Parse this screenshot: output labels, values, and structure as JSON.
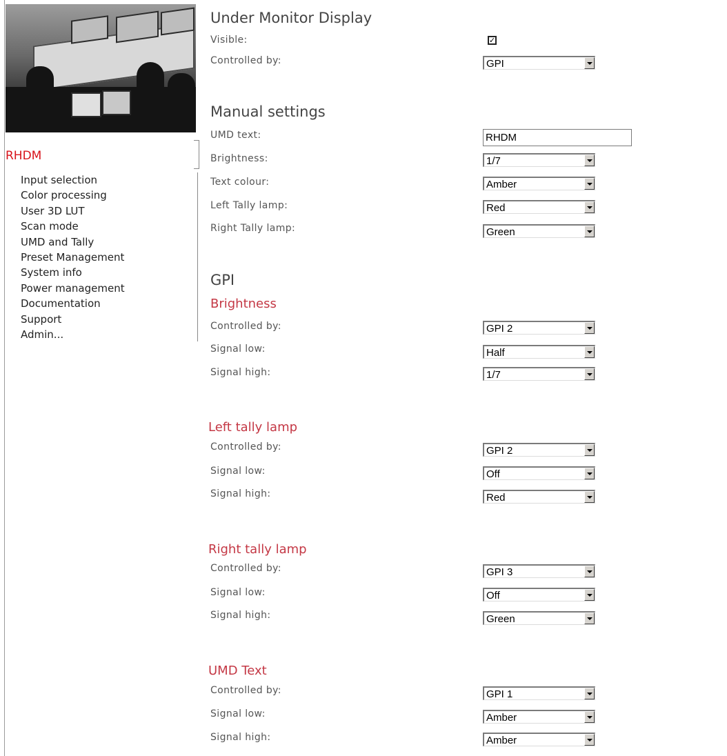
{
  "sidebar": {
    "brand": "RHDM",
    "items": [
      "Input selection",
      "Color processing",
      "User 3D LUT",
      "Scan mode",
      "UMD and Tally",
      "Preset Management",
      "System info",
      "Power management",
      "Documentation",
      "Support",
      "Admin..."
    ]
  },
  "umd": {
    "title": "Under Monitor Display",
    "visible_label": "Visible:",
    "visible_checked": true,
    "visible_mark": "✓",
    "controlled_label": "Controlled by:",
    "controlled_value": "GPI"
  },
  "manual": {
    "title": "Manual settings",
    "text_label": "UMD text:",
    "text_value": "RHDM",
    "brightness_label": "Brightness:",
    "brightness_value": "1/7",
    "colour_label": "Text colour:",
    "colour_value": "Amber",
    "left_label": "Left Tally lamp:",
    "left_value": "Red",
    "right_label": "Right Tally lamp:",
    "right_value": "Green"
  },
  "gpi": {
    "title": "GPI",
    "labels": {
      "controlled": "Controlled by:",
      "low": "Signal low:",
      "high": "Signal high:"
    },
    "brightness": {
      "title": "Brightness",
      "controlled": "GPI 2",
      "low": "Half",
      "high": "1/7"
    },
    "left_tally": {
      "title": "Left tally lamp",
      "controlled": "GPI 2",
      "low": "Off",
      "high": "Red"
    },
    "right_tally": {
      "title": "Right tally lamp",
      "controlled": "GPI 3",
      "low": "Off",
      "high": "Green"
    },
    "umd_text": {
      "title": "UMD Text",
      "controlled": "GPI 1",
      "low": "Amber",
      "high": "Amber"
    }
  },
  "colors": {
    "accent": "#d8131a",
    "section_title": "#c43845",
    "label": "#555555"
  }
}
